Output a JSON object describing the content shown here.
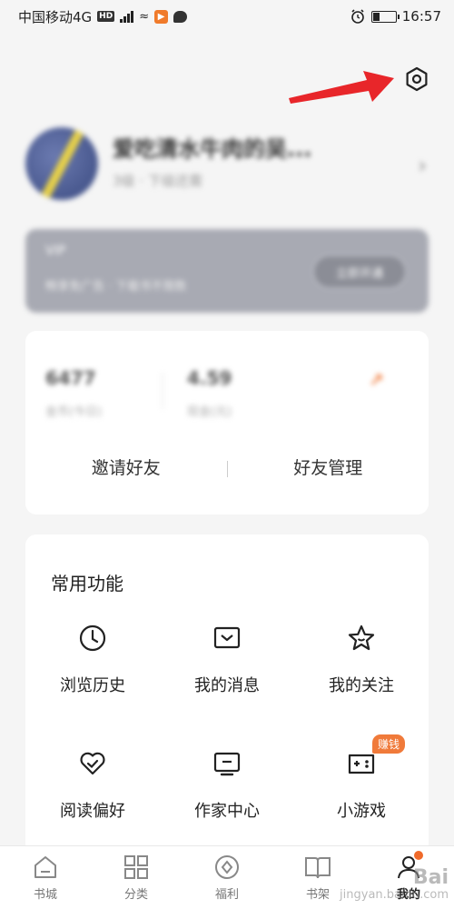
{
  "status_bar": {
    "carrier": "中国移动4G",
    "hd": "HD",
    "network": "4G",
    "time": "16:57"
  },
  "profile": {
    "nickname": "爱吃清水牛肉的吴...",
    "subtitle": "3级 · 下级还需"
  },
  "vip": {
    "title": "VIP",
    "desc": "畅享免广告 · 下载书不限数",
    "button": "立即开通"
  },
  "stats": {
    "items": [
      {
        "num": "6477",
        "label": "金币(今日)"
      },
      {
        "num": "4.59",
        "label": "现金(元)"
      }
    ],
    "friend_row": [
      "邀请好友",
      "好友管理"
    ]
  },
  "functions": {
    "title": "常用功能",
    "items": [
      {
        "label": "浏览历史",
        "icon": "clock-icon"
      },
      {
        "label": "我的消息",
        "icon": "message-icon"
      },
      {
        "label": "我的关注",
        "icon": "star-icon"
      },
      {
        "label": "阅读偏好",
        "icon": "heart-check-icon"
      },
      {
        "label": "作家中心",
        "icon": "monitor-icon"
      },
      {
        "label": "小游戏",
        "icon": "gamepad-icon",
        "badge": "赚钱"
      }
    ]
  },
  "bottom_nav": {
    "items": [
      {
        "label": "书城",
        "icon": "home-icon"
      },
      {
        "label": "分类",
        "icon": "grid-icon"
      },
      {
        "label": "福利",
        "icon": "gift-icon"
      },
      {
        "label": "书架",
        "icon": "book-icon"
      },
      {
        "label": "我的",
        "icon": "user-icon",
        "active": true
      }
    ]
  },
  "watermark": {
    "line1": "Bai",
    "line2": "jingyan.baidu.com"
  },
  "colors": {
    "accent": "#f07a3a",
    "annotation_arrow": "#e8262a",
    "background": "#f5f5f5"
  }
}
